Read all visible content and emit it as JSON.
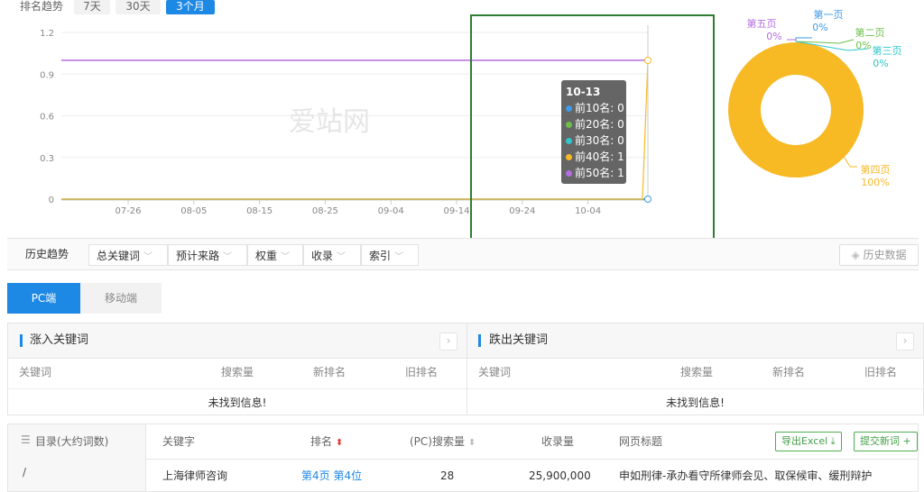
{
  "ranking_trend": {
    "label": "排名趋势",
    "ranges": [
      "7天",
      "30天",
      "3个月"
    ],
    "active_range": "3个月"
  },
  "tooltip": {
    "date": "10-13",
    "rows": [
      {
        "label": "前10名",
        "value": "0",
        "color": "#3d9be9"
      },
      {
        "label": "前20名",
        "value": "0",
        "color": "#6cc04a"
      },
      {
        "label": "前30名",
        "value": "0",
        "color": "#2ec7c9"
      },
      {
        "label": "前40名",
        "value": "1",
        "color": "#f7b924"
      },
      {
        "label": "前50名",
        "value": "1",
        "color": "#b36ee0"
      }
    ]
  },
  "watermark": "爱站网",
  "chart_data": [
    {
      "type": "line",
      "title": "",
      "xlabel": "",
      "ylabel": "",
      "ylim": [
        0,
        1.2
      ],
      "yticks": [
        "0",
        "0.3",
        "0.6",
        "0.9",
        "1.2"
      ],
      "xticks": [
        "07-26",
        "08-05",
        "08-15",
        "08-25",
        "09-04",
        "09-14",
        "09-24",
        "10-04"
      ],
      "grid": true,
      "series": [
        {
          "values_desc": "0 for all dates through 10-12, 0 on 10-13",
          "color": "#3d9be9",
          "start": 0,
          "end": 0
        },
        {
          "color": "#b36ee0",
          "start": 1,
          "end": 1
        },
        {
          "color": "#f7b924",
          "start": 0,
          "end": 1
        }
      ]
    },
    {
      "type": "pie",
      "title": "",
      "slices": [
        {
          "label": "第一页",
          "value": 0,
          "display": "0%",
          "color": "#3d9be9"
        },
        {
          "label": "第二页",
          "value": 0,
          "display": "0%",
          "color": "#6cc04a"
        },
        {
          "label": "第三页",
          "value": 0,
          "display": "0%",
          "color": "#2ec7c9"
        },
        {
          "label": "第四页",
          "value": 100,
          "display": "100%",
          "color": "#f7b924"
        },
        {
          "label": "第五页",
          "value": 0,
          "display": "0%",
          "color": "#b36ee0"
        }
      ]
    }
  ],
  "filters": {
    "title": "历史趋势",
    "dropdowns": [
      "总关键词",
      "预计来路",
      "权重",
      "收录",
      "索引"
    ],
    "history_button": "历史数据"
  },
  "device_tabs": [
    "PC端",
    "移动端"
  ],
  "gain_panel": {
    "title": "涨入关键词",
    "columns": [
      "关键词",
      "搜索量",
      "新排名",
      "旧排名"
    ],
    "empty": "未找到信息!"
  },
  "loss_panel": {
    "title": "跌出关键词",
    "columns": [
      "关键词",
      "搜索量",
      "新排名",
      "旧排名"
    ],
    "empty": "未找到信息!"
  },
  "catalog": {
    "title": "目录(大约词数)",
    "row": "/"
  },
  "results": {
    "columns": [
      "关键字",
      "排名",
      "(PC)搜索量",
      "收录量",
      "网页标题"
    ],
    "export_button": "导出Excel",
    "submit_button": "提交新词",
    "rows": [
      {
        "keyword": "上海律师咨询",
        "rank": "第4页 第4位",
        "volume": "28",
        "indexed": "25,900,000",
        "page_title": "申如刑律-承办看守所律师会见、取保候审、缓刑辩护"
      }
    ]
  },
  "colors": {
    "accent": "#1e88e5",
    "donut": "#f7b924",
    "highlight": "#2e7d32"
  }
}
